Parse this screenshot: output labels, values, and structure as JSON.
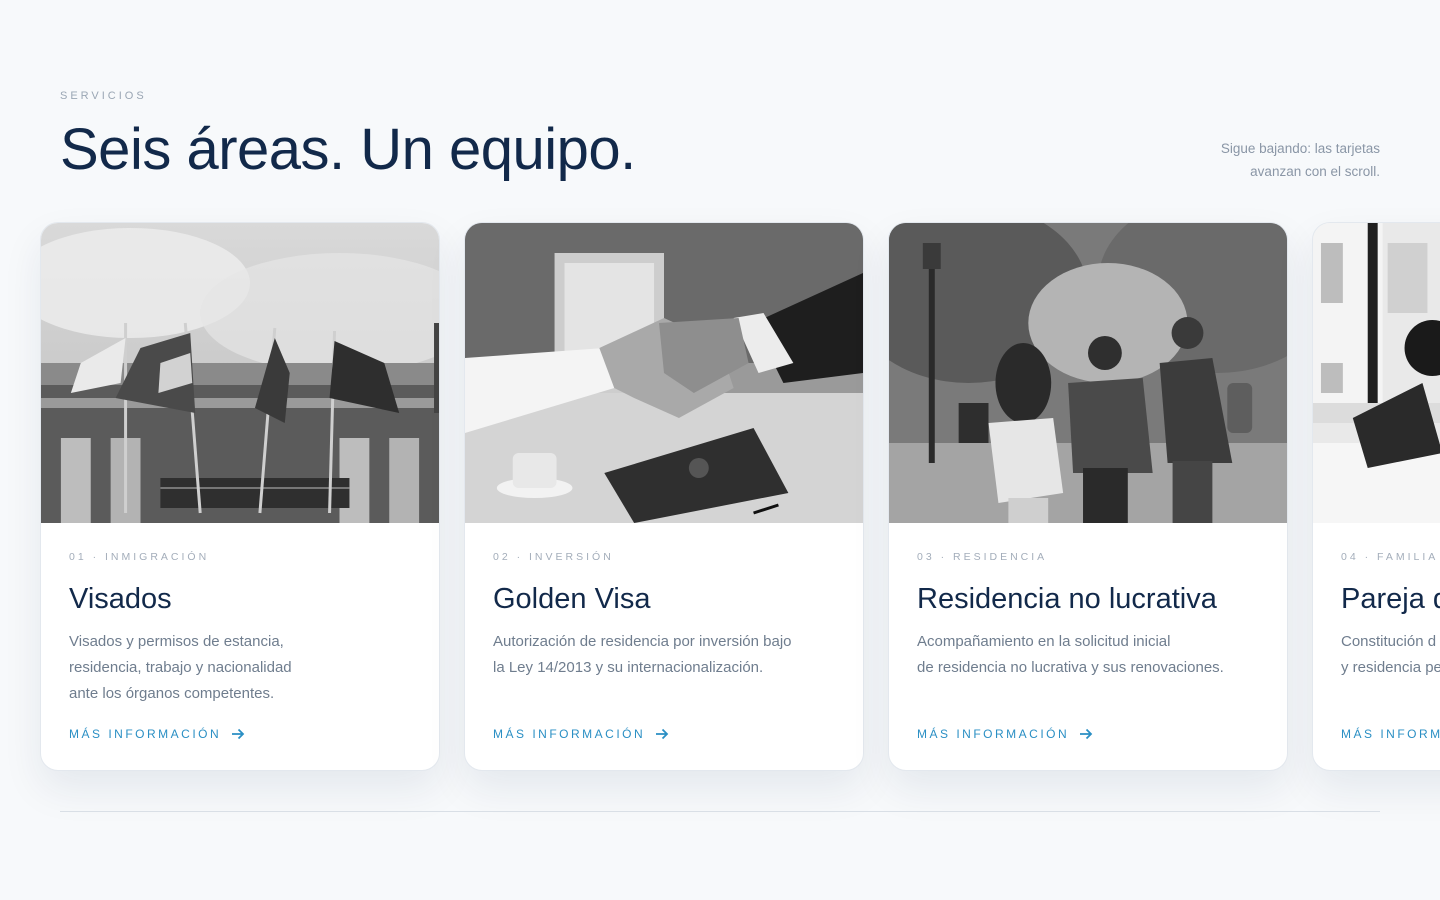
{
  "section": {
    "eyebrow": "SERVICIOS",
    "title": "Seis áreas. Un equipo.",
    "hint": "Sigue bajando: las tarjetas avanzan con el scroll."
  },
  "cards": [
    {
      "kicker": "01 · INMIGRACIÓN",
      "title": "Visados",
      "description": "Visados y permisos de estancia,\nresidencia, trabajo y nacionalidad\nante los órganos competentes.",
      "link": "MÁS INFORMACIÓN",
      "image": "flags-building-photo"
    },
    {
      "kicker": "02 · INVERSIÓN",
      "title": "Golden Visa",
      "description": "Autorización de residencia por inversión bajo\nla Ley 14/2013 y su internacionalización.",
      "link": "MÁS INFORMACIÓN",
      "image": "handshake-photo"
    },
    {
      "kicker": "03 · RESIDENCIA",
      "title": "Residencia no lucrativa",
      "description": "Acompañamiento en la solicitud inicial\nde residencia no lucrativa y sus renovaciones.",
      "link": "MÁS INFORMACIÓN",
      "image": "students-park-photo"
    },
    {
      "kicker": "04 · FAMILIA",
      "title": "Pareja d",
      "description": "Constitución d\ny residencia pe",
      "link": "MÁS INFORMA",
      "image": "woman-writing-photo"
    }
  ],
  "colors": {
    "background": "#f7f9fb",
    "heading": "#12294a",
    "accent": "#2a8fc4",
    "muted": "#6f7d8e"
  },
  "icons": {
    "link_arrow": "arrow-right-icon"
  }
}
